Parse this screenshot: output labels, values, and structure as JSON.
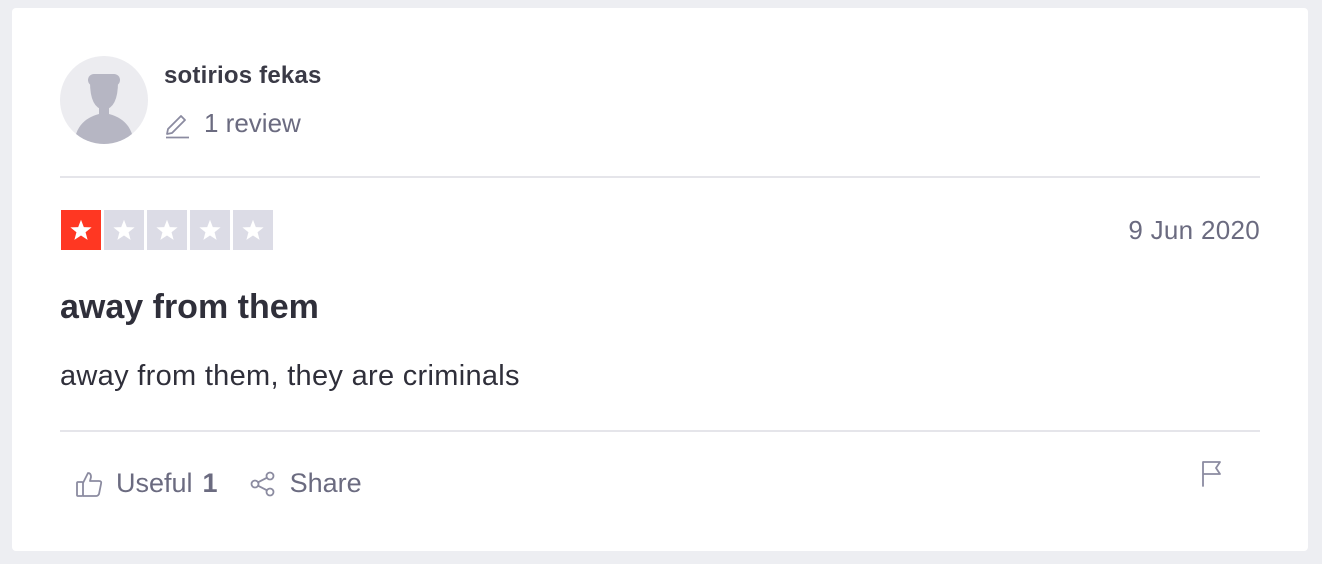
{
  "consumer": {
    "name": "sotirios fekas",
    "review_count_label": "1 review"
  },
  "review": {
    "rating": 1,
    "rating_max": 5,
    "date": "9 Jun 2020",
    "title": "away from them",
    "text": "away from them, they are criminals"
  },
  "actions": {
    "useful_label": "Useful",
    "useful_count": "1",
    "share_label": "Share"
  },
  "icons": {
    "avatar": "person-silhouette-icon",
    "reviews": "pencil-icon",
    "useful": "thumbs-up-icon",
    "share": "share-icon",
    "report": "flag-icon",
    "star": "star-icon"
  },
  "colors": {
    "star_filled": "#ff3722",
    "star_empty": "#dcdce6",
    "text_primary": "#2f2f3a",
    "text_secondary": "#6b6b80"
  }
}
